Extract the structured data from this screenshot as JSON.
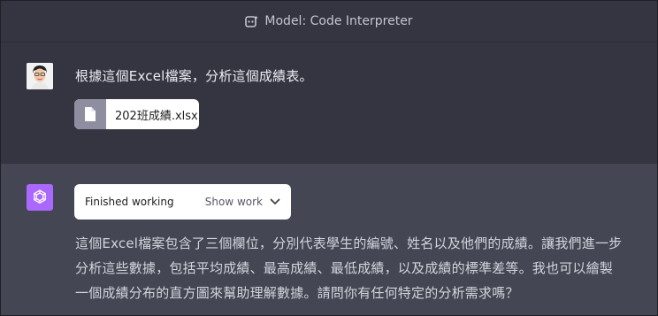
{
  "header": {
    "model_label": "Model: Code Interpreter",
    "model_icon": "code-interpreter-icon"
  },
  "user_message": {
    "text": "根據這個Excel檔案，分析這個成績表。",
    "avatar_icon": "user-avatar",
    "attachment": {
      "file_name": "202班成績.xlsx",
      "icon": "file-icon"
    }
  },
  "assistant_message": {
    "avatar_icon": "openai-logo-icon",
    "avatar_color": "#ab68ff",
    "work_status": {
      "label": "Finished working",
      "toggle_label": "Show work",
      "toggle_icon": "chevron-down-icon"
    },
    "lines": [
      "這個Excel檔案包含了三個欄位，分別代表學生的編號、姓名以及他們的成績。讓我們進一步",
      "分析這些數據，包括平均成績、最高成績、最低成績，以及成績的標準差等。我也可以繪製",
      "一個成績分布的直方圖來幫助理解數據。請問你有任何特定的分析需求嗎？"
    ]
  }
}
